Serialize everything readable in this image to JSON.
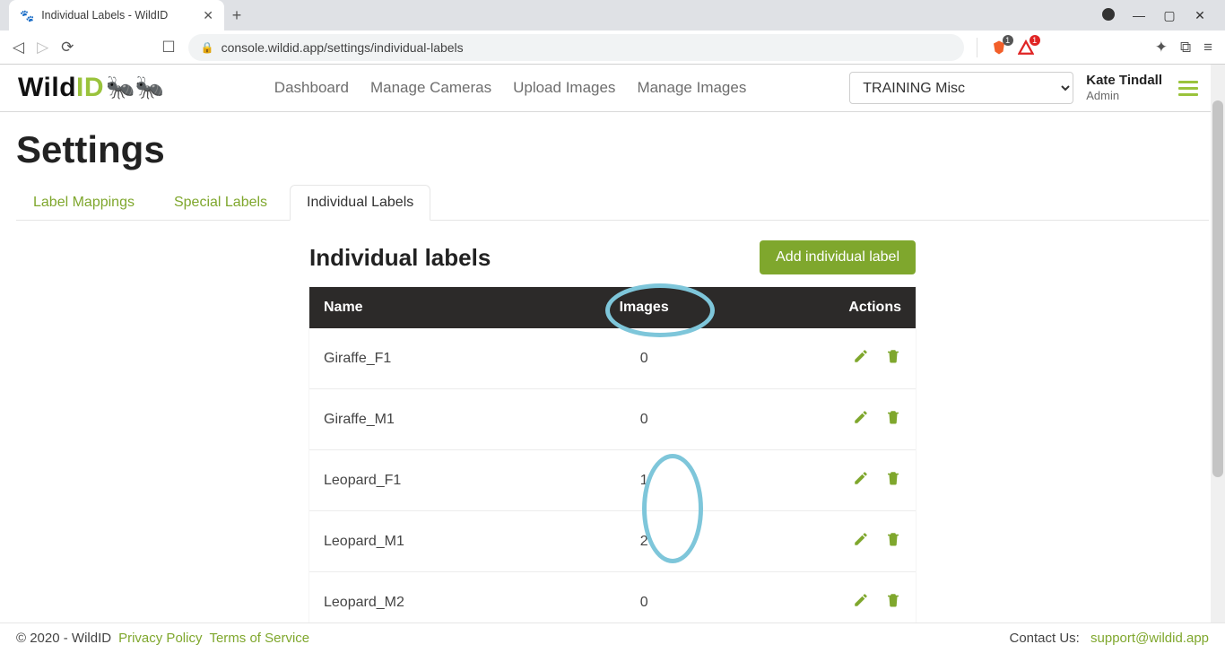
{
  "browser": {
    "tab_title": "Individual Labels - WildID",
    "url": "console.wildid.app/settings/individual-labels",
    "ext_badge_1": "1",
    "ext_badge_2": "1"
  },
  "app": {
    "logo_wild": "Wild",
    "logo_id": "ID",
    "nav": {
      "dashboard": "Dashboard",
      "manage_cameras": "Manage Cameras",
      "upload_images": "Upload Images",
      "manage_images": "Manage Images"
    },
    "project_selected": "TRAINING Misc",
    "user_name": "Kate Tindall",
    "user_role": "Admin"
  },
  "page": {
    "title": "Settings",
    "tabs": {
      "label_mappings": "Label Mappings",
      "special_labels": "Special Labels",
      "individual_labels": "Individual Labels"
    },
    "section_title": "Individual labels",
    "add_button": "Add individual label",
    "columns": {
      "name": "Name",
      "images": "Images",
      "actions": "Actions"
    },
    "rows": [
      {
        "name": "Giraffe_F1",
        "images": "0"
      },
      {
        "name": "Giraffe_M1",
        "images": "0"
      },
      {
        "name": "Leopard_F1",
        "images": "1"
      },
      {
        "name": "Leopard_M1",
        "images": "2"
      },
      {
        "name": "Leopard_M2",
        "images": "0"
      }
    ]
  },
  "footer": {
    "copyright": "© 2020 - WildID",
    "privacy": "Privacy Policy",
    "terms": "Terms of Service",
    "contact_label": "Contact Us:",
    "contact_email": "support@wildid.app"
  }
}
